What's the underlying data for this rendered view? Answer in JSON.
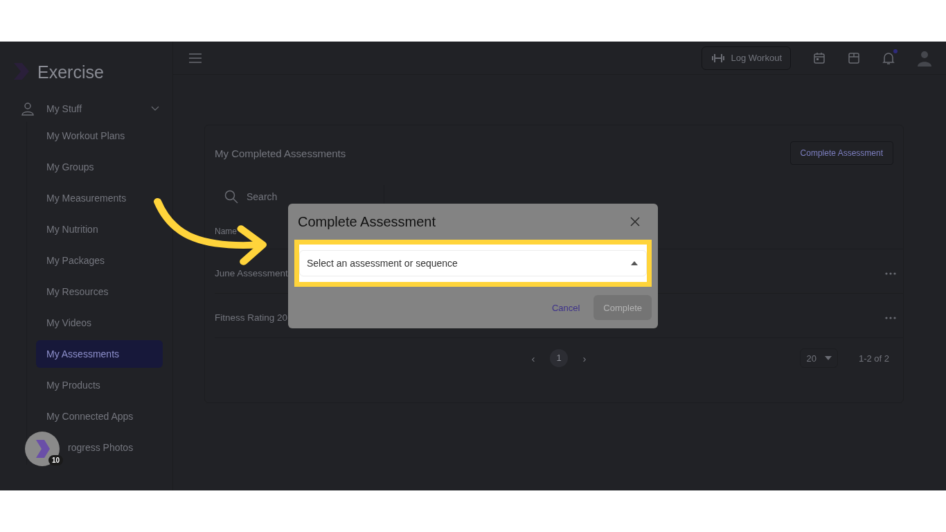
{
  "brand": {
    "name": "Exercise"
  },
  "sidebar": {
    "group": {
      "label": "My Stuff",
      "expanded": true
    },
    "items": [
      {
        "label": "My Workout Plans",
        "selected": false
      },
      {
        "label": "My Groups",
        "selected": false
      },
      {
        "label": "My Measurements",
        "selected": false
      },
      {
        "label": "My Nutrition",
        "selected": false
      },
      {
        "label": "My Packages",
        "selected": false
      },
      {
        "label": "My Resources",
        "selected": false
      },
      {
        "label": "My Videos",
        "selected": false
      },
      {
        "label": "My Assessments",
        "selected": true
      },
      {
        "label": "My Products",
        "selected": false
      },
      {
        "label": "My Connected Apps",
        "selected": false
      },
      {
        "label": "rogress Photos",
        "selected": false
      }
    ]
  },
  "topbar": {
    "log_button": "Log Workout",
    "notification_unread": true
  },
  "card": {
    "title": "My Completed Assessments",
    "action": "Complete Assessment",
    "search": {
      "placeholder": "Search"
    },
    "columns": [
      "Name"
    ],
    "rows": [
      {
        "name": "June Assessment"
      },
      {
        "name": "Fitness Rating 20"
      }
    ],
    "pagination": {
      "prev": "‹",
      "page": "1",
      "next": "›",
      "page_size": "20",
      "range": "1-2 of 2"
    }
  },
  "modal": {
    "title": "Complete Assessment",
    "select": {
      "placeholder": "Select an assessment or sequence",
      "open": true
    },
    "cancel": "Cancel",
    "complete": {
      "label": "Complete",
      "disabled": true
    }
  },
  "chat": {
    "badge": "10"
  }
}
